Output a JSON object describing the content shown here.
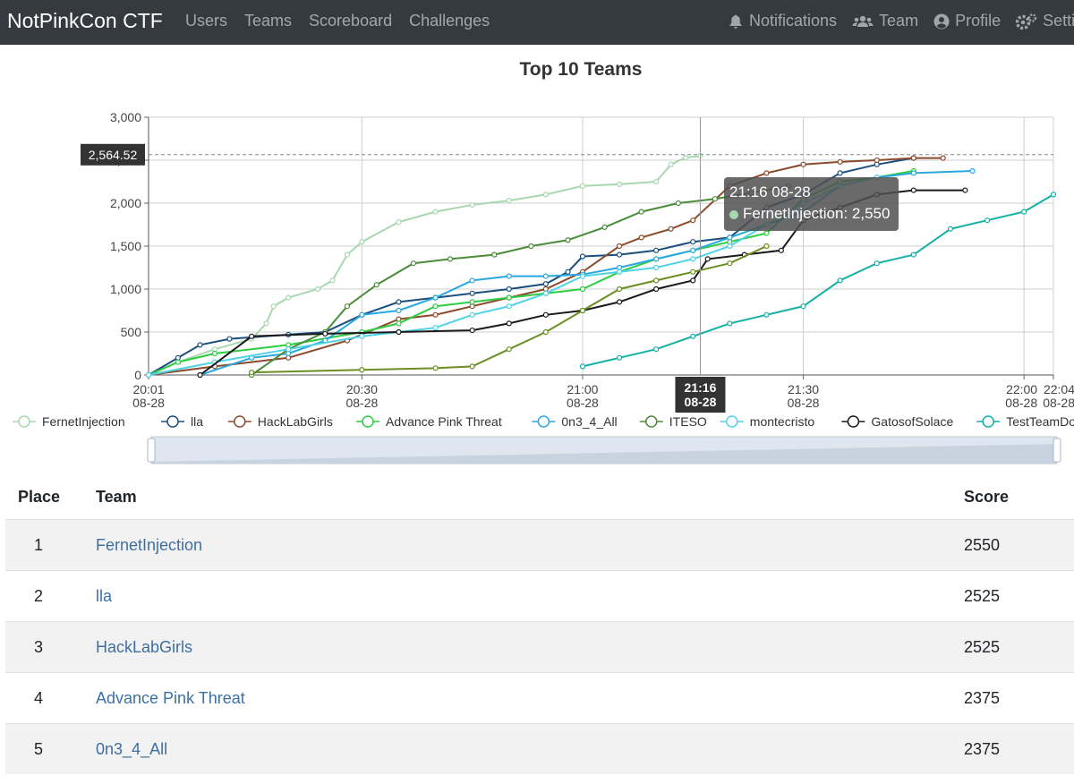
{
  "navbar": {
    "brand": "NotPinkCon CTF",
    "left_links": [
      "Users",
      "Teams",
      "Scoreboard",
      "Challenges"
    ],
    "right_links": [
      {
        "label": "Notifications",
        "icon": "bell-icon"
      },
      {
        "label": "Team",
        "icon": "users-icon"
      },
      {
        "label": "Profile",
        "icon": "user-circle-icon"
      },
      {
        "label": "Settings",
        "icon": "gears-icon"
      }
    ]
  },
  "chart_data": {
    "type": "line",
    "title": "Top 10 Teams",
    "ylim": [
      0,
      3000
    ],
    "yticks": [
      "0",
      "500",
      "1,000",
      "1,500",
      "2,000",
      "2,500",
      "3,000"
    ],
    "xlim": [
      "20:01",
      "22:04"
    ],
    "xticks": [
      {
        "t": "20:01",
        "label": "20:01",
        "date": "08-28"
      },
      {
        "t": "20:30",
        "label": "20:30",
        "date": "08-28"
      },
      {
        "t": "21:00",
        "label": "21:00",
        "date": "08-28"
      },
      {
        "t": "21:30",
        "label": "21:30",
        "date": "08-28"
      },
      {
        "t": "22:00",
        "label": "22:00",
        "date": "08-28"
      },
      {
        "t": "22:04",
        "label": "22:04",
        "date": "08-28"
      }
    ],
    "grid": true,
    "legend_position": "bottom",
    "pointer": {
      "time": "21:16",
      "date": "08-28",
      "value_label": "2,564.52",
      "value": 2564.52
    },
    "tooltip": {
      "title": "21:16 08-28",
      "series": "FernetInjection",
      "value": "2,550"
    },
    "series": [
      {
        "name": "FernetInjection",
        "color": "#a8d8b0",
        "points": [
          [
            "20:01",
            0
          ],
          [
            "20:05",
            150
          ],
          [
            "20:10",
            300
          ],
          [
            "20:15",
            420
          ],
          [
            "20:17",
            600
          ],
          [
            "20:18",
            800
          ],
          [
            "20:20",
            900
          ],
          [
            "20:24",
            1000
          ],
          [
            "20:26",
            1100
          ],
          [
            "20:28",
            1400
          ],
          [
            "20:30",
            1550
          ],
          [
            "20:35",
            1780
          ],
          [
            "20:40",
            1900
          ],
          [
            "20:45",
            1980
          ],
          [
            "20:50",
            2030
          ],
          [
            "20:55",
            2100
          ],
          [
            "21:00",
            2200
          ],
          [
            "21:05",
            2220
          ],
          [
            "21:10",
            2250
          ],
          [
            "21:12",
            2450
          ],
          [
            "21:14",
            2530
          ],
          [
            "21:16",
            2550
          ]
        ]
      },
      {
        "name": "lla",
        "color": "#1c4e80",
        "points": [
          [
            "20:01",
            0
          ],
          [
            "20:05",
            200
          ],
          [
            "20:08",
            350
          ],
          [
            "20:12",
            420
          ],
          [
            "20:20",
            470
          ],
          [
            "20:25",
            500
          ],
          [
            "20:30",
            700
          ],
          [
            "20:35",
            850
          ],
          [
            "20:40",
            900
          ],
          [
            "20:45",
            950
          ],
          [
            "20:50",
            1000
          ],
          [
            "20:55",
            1060
          ],
          [
            "20:58",
            1200
          ],
          [
            "21:00",
            1380
          ],
          [
            "21:05",
            1400
          ],
          [
            "21:10",
            1450
          ],
          [
            "21:15",
            1550
          ],
          [
            "21:20",
            1600
          ],
          [
            "21:25",
            1950
          ],
          [
            "21:30",
            2100
          ],
          [
            "21:35",
            2350
          ],
          [
            "21:40",
            2450
          ],
          [
            "21:45",
            2525
          ]
        ]
      },
      {
        "name": "HackLabGirls",
        "color": "#8b4a2b",
        "points": [
          [
            "20:01",
            0
          ],
          [
            "20:10",
            100
          ],
          [
            "20:20",
            200
          ],
          [
            "20:28",
            400
          ],
          [
            "20:35",
            650
          ],
          [
            "20:40",
            700
          ],
          [
            "20:45",
            800
          ],
          [
            "20:50",
            900
          ],
          [
            "20:55",
            1000
          ],
          [
            "21:00",
            1200
          ],
          [
            "21:05",
            1500
          ],
          [
            "21:08",
            1600
          ],
          [
            "21:12",
            1700
          ],
          [
            "21:15",
            1800
          ],
          [
            "21:20",
            2200
          ],
          [
            "21:25",
            2350
          ],
          [
            "21:30",
            2450
          ],
          [
            "21:35",
            2480
          ],
          [
            "21:40",
            2500
          ],
          [
            "21:45",
            2525
          ],
          [
            "21:49",
            2525
          ]
        ]
      },
      {
        "name": "Advance Pink Threat",
        "color": "#2ecc40",
        "points": [
          [
            "20:01",
            0
          ],
          [
            "20:05",
            150
          ],
          [
            "20:10",
            250
          ],
          [
            "20:20",
            350
          ],
          [
            "20:30",
            500
          ],
          [
            "20:35",
            600
          ],
          [
            "20:40",
            800
          ],
          [
            "20:45",
            850
          ],
          [
            "20:50",
            900
          ],
          [
            "20:55",
            950
          ],
          [
            "21:00",
            1000
          ],
          [
            "21:05",
            1200
          ],
          [
            "21:10",
            1350
          ],
          [
            "21:15",
            1450
          ],
          [
            "21:20",
            1550
          ],
          [
            "21:25",
            1650
          ],
          [
            "21:30",
            2050
          ],
          [
            "21:35",
            2250
          ],
          [
            "21:40",
            2300
          ],
          [
            "21:45",
            2375
          ]
        ]
      },
      {
        "name": "0n3_4_All",
        "color": "#29a8e0",
        "points": [
          [
            "20:08",
            0
          ],
          [
            "20:15",
            200
          ],
          [
            "20:20",
            250
          ],
          [
            "20:25",
            400
          ],
          [
            "20:30",
            700
          ],
          [
            "20:35",
            750
          ],
          [
            "20:40",
            900
          ],
          [
            "20:45",
            1100
          ],
          [
            "20:50",
            1150
          ],
          [
            "20:55",
            1150
          ],
          [
            "21:00",
            1170
          ],
          [
            "21:05",
            1250
          ],
          [
            "21:10",
            1350
          ],
          [
            "21:15",
            1450
          ],
          [
            "21:20",
            1600
          ],
          [
            "21:25",
            1750
          ],
          [
            "21:30",
            1900
          ],
          [
            "21:35",
            2200
          ],
          [
            "21:40",
            2300
          ],
          [
            "21:45",
            2350
          ],
          [
            "21:53",
            2375
          ]
        ]
      },
      {
        "name": "ITESO",
        "color": "#4a8c3a",
        "points": [
          [
            "20:15",
            0
          ],
          [
            "20:20",
            300
          ],
          [
            "20:25",
            500
          ],
          [
            "20:28",
            800
          ],
          [
            "20:32",
            1050
          ],
          [
            "20:37",
            1300
          ],
          [
            "20:42",
            1350
          ],
          [
            "20:48",
            1400
          ],
          [
            "20:53",
            1500
          ],
          [
            "20:58",
            1570
          ],
          [
            "21:03",
            1720
          ],
          [
            "21:08",
            1900
          ],
          [
            "21:13",
            2000
          ],
          [
            "21:18",
            2050
          ],
          [
            "21:23",
            2120
          ],
          [
            "21:28",
            2200
          ]
        ]
      },
      {
        "name": "montecristo",
        "color": "#4fd2e8",
        "points": [
          [
            "20:01",
            0
          ],
          [
            "20:10",
            150
          ],
          [
            "20:20",
            300
          ],
          [
            "20:30",
            450
          ],
          [
            "20:40",
            550
          ],
          [
            "20:45",
            700
          ],
          [
            "20:50",
            800
          ],
          [
            "20:55",
            950
          ],
          [
            "21:00",
            1150
          ],
          [
            "21:05",
            1200
          ],
          [
            "21:10",
            1250
          ],
          [
            "21:15",
            1350
          ],
          [
            "21:20",
            1500
          ],
          [
            "21:25",
            1750
          ],
          [
            "21:30",
            2000
          ],
          [
            "21:35",
            2200
          ],
          [
            "21:40",
            2300
          ]
        ]
      },
      {
        "name": "GatosofSolace",
        "color": "#1a1a1a",
        "points": [
          [
            "20:08",
            0
          ],
          [
            "20:15",
            450
          ],
          [
            "20:25",
            480
          ],
          [
            "20:35",
            500
          ],
          [
            "20:45",
            520
          ],
          [
            "20:50",
            600
          ],
          [
            "20:55",
            700
          ],
          [
            "21:00",
            750
          ],
          [
            "21:05",
            850
          ],
          [
            "21:10",
            1000
          ],
          [
            "21:15",
            1100
          ],
          [
            "21:17",
            1350
          ],
          [
            "21:22",
            1400
          ],
          [
            "21:27",
            1450
          ],
          [
            "21:30",
            1800
          ],
          [
            "21:35",
            1950
          ],
          [
            "21:40",
            2100
          ],
          [
            "21:45",
            2150
          ],
          [
            "21:52",
            2150
          ]
        ]
      },
      {
        "name": "TestTeamDoNotJoin",
        "color": "#13b0a5",
        "points": [
          [
            "21:00",
            100
          ],
          [
            "21:05",
            200
          ],
          [
            "21:10",
            300
          ],
          [
            "21:15",
            450
          ],
          [
            "21:20",
            600
          ],
          [
            "21:25",
            700
          ],
          [
            "21:30",
            800
          ],
          [
            "21:35",
            1100
          ],
          [
            "21:40",
            1300
          ],
          [
            "21:45",
            1400
          ],
          [
            "21:50",
            1700
          ],
          [
            "21:55",
            1800
          ],
          [
            "22:00",
            1900
          ],
          [
            "22:04",
            2100
          ]
        ]
      },
      {
        "name": "",
        "color": "#6b8e23",
        "points": [
          [
            "20:15",
            30
          ],
          [
            "20:30",
            60
          ],
          [
            "20:40",
            80
          ],
          [
            "20:45",
            100
          ],
          [
            "20:50",
            300
          ],
          [
            "20:55",
            500
          ],
          [
            "21:00",
            750
          ],
          [
            "21:05",
            1000
          ],
          [
            "21:10",
            1100
          ],
          [
            "21:15",
            1200
          ],
          [
            "21:20",
            1300
          ],
          [
            "21:25",
            1500
          ]
        ]
      }
    ]
  },
  "scoreboard": {
    "headers": {
      "place": "Place",
      "team": "Team",
      "score": "Score"
    },
    "rows": [
      {
        "place": "1",
        "team": "FernetInjection",
        "score": "2550"
      },
      {
        "place": "2",
        "team": "lla",
        "score": "2525"
      },
      {
        "place": "3",
        "team": "HackLabGirls",
        "score": "2525"
      },
      {
        "place": "4",
        "team": "Advance Pink Threat",
        "score": "2375"
      },
      {
        "place": "5",
        "team": "0n3_4_All",
        "score": "2375"
      }
    ]
  }
}
